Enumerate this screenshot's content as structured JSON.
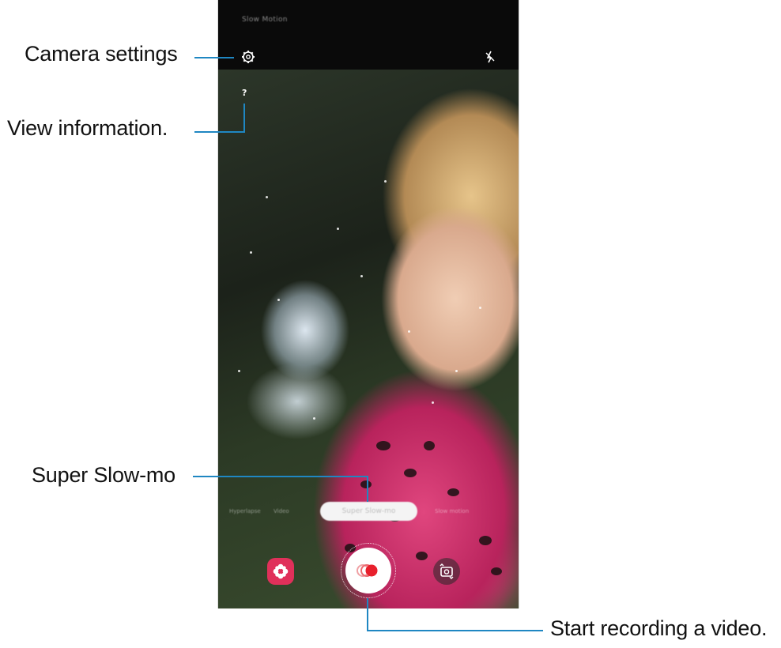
{
  "screen": {
    "mode_title": "Slow Motion",
    "info_button": "?",
    "mode_pill": "Super Slow-mo",
    "mode_left_ghost": "Hyperlapse",
    "mode_left_ghost2": "Video",
    "mode_right_ghost": "Slow motion",
    "icons": {
      "settings": "gear-icon",
      "flash": "flash-off-icon",
      "bixby": "bixby-vision-icon",
      "record": "super-slow-mo-record-icon",
      "switch": "switch-camera-icon"
    }
  },
  "annotations": {
    "camera_settings": "Camera settings",
    "view_information": "View information.",
    "super_slow_mo": "Super Slow-mo",
    "start_recording": "Start recording a video."
  },
  "colors": {
    "annotation_line": "#1f87c2",
    "record_accent": "#e8202c",
    "bixby_bg": "#e0305a"
  }
}
